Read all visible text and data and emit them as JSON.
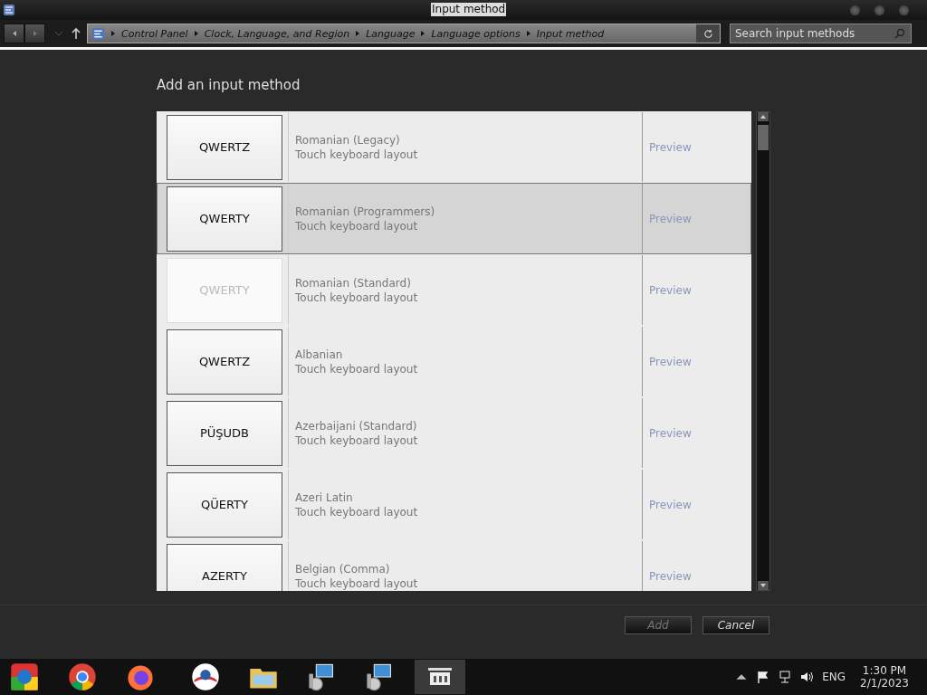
{
  "window": {
    "title": "Input method"
  },
  "breadcrumb": [
    "Control Panel",
    "Clock, Language, and Region",
    "Language",
    "Language options",
    "Input method"
  ],
  "search": {
    "placeholder": "Search input methods"
  },
  "heading": "Add an input method",
  "methods": [
    {
      "key": "QWERTZ",
      "name": "Romanian (Legacy)",
      "description": "Touch keyboard layout",
      "preview": "Preview",
      "selected": false,
      "disabled": false
    },
    {
      "key": "QWERTY",
      "name": "Romanian (Programmers)",
      "description": "Touch keyboard layout",
      "preview": "Preview",
      "selected": true,
      "disabled": false
    },
    {
      "key": "QWERTY",
      "name": "Romanian (Standard)",
      "description": "Touch keyboard layout",
      "preview": "Preview",
      "selected": false,
      "disabled": true
    },
    {
      "key": "QWERTZ",
      "name": "Albanian",
      "description": "Touch keyboard layout",
      "preview": "Preview",
      "selected": false,
      "disabled": false
    },
    {
      "key": "PÜŞUDB",
      "name": "Azerbaijani (Standard)",
      "description": "Touch keyboard layout",
      "preview": "Preview",
      "selected": false,
      "disabled": false
    },
    {
      "key": "QÜERTY",
      "name": "Azeri Latin",
      "description": "Touch keyboard layout",
      "preview": "Preview",
      "selected": false,
      "disabled": false
    },
    {
      "key": "AZERTY",
      "name": "Belgian (Comma)",
      "description": "Touch keyboard layout",
      "preview": "Preview",
      "selected": false,
      "disabled": false
    }
  ],
  "buttons": [
    {
      "label": "Add",
      "disabled": true
    },
    {
      "label": "Cancel",
      "disabled": false
    }
  ],
  "tray": {
    "language": "ENG",
    "time": "1:30 PM",
    "date": "2/1/2023"
  }
}
